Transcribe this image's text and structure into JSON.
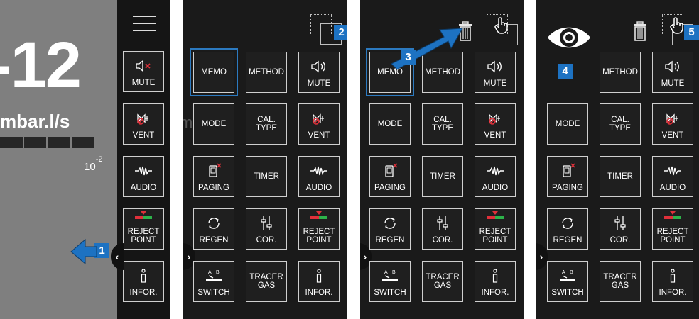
{
  "panel1": {
    "reading_value": "-12",
    "reading_unit": "mbar.l/s",
    "scale_base": "10",
    "scale_exp": "-2",
    "sidebar_buttons": [
      {
        "label": "MUTE",
        "icon": "speaker-mute-icon"
      },
      {
        "label": "VENT",
        "icon": "vent-valve-icon"
      },
      {
        "label": "AUDIO",
        "icon": "audio-wave-icon"
      },
      {
        "label": "REJECT\nPOINT",
        "icon": "reject-point-icon"
      },
      {
        "label": "INFOR.",
        "icon": "info-icon"
      }
    ],
    "badge": "1"
  },
  "panel2": {
    "badge": "2",
    "buttons": [
      [
        "MEMO",
        "METHOD",
        "MUTE"
      ],
      [
        "MODE",
        "CAL. TYPE",
        "VENT"
      ],
      [
        "PAGING",
        "TIMER",
        "AUDIO"
      ],
      [
        "REGEN",
        "COR.",
        "REJECT\nPOINT"
      ],
      [
        "SWITCH",
        "TRACER\nGAS",
        "INFOR."
      ]
    ],
    "partial_letters": [
      "m",
      "m"
    ]
  },
  "panel3": {
    "badge": "3",
    "buttons": [
      [
        "MEMO",
        "METHOD",
        "MUTE"
      ],
      [
        "MODE",
        "CAL. TYPE",
        "VENT"
      ],
      [
        "PAGING",
        "TIMER",
        "AUDIO"
      ],
      [
        "REGEN",
        "COR.",
        "REJECT\nPOINT"
      ],
      [
        "SWITCH",
        "TRACER\nGAS",
        "INFOR."
      ]
    ]
  },
  "panel4": {
    "badges": [
      "4",
      "5"
    ],
    "buttons": [
      [
        "",
        "METHOD",
        "MUTE"
      ],
      [
        "MODE",
        "CAL. TYPE",
        "VENT"
      ],
      [
        "PAGING",
        "TIMER",
        "AUDIO"
      ],
      [
        "REGEN",
        "COR.",
        "REJECT\nPOINT"
      ],
      [
        "SWITCH",
        "TRACER\nGAS",
        "INFOR."
      ]
    ]
  },
  "colors": {
    "accent": "#1d72c2",
    "select_frame": "#2c7ac0",
    "alert_red": "#e0303a",
    "reject_green": "#2db34a"
  }
}
